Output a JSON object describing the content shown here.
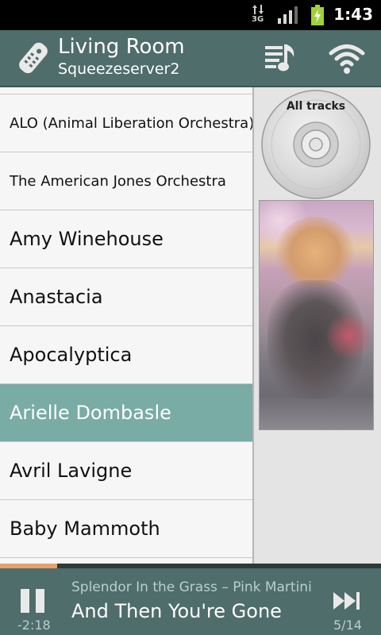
{
  "status_bar": {
    "network_label": "3G",
    "time": "1:43"
  },
  "header": {
    "title": "Living Room",
    "subtitle": "Squeezeserver2",
    "icons": [
      "remote-icon",
      "playlist-icon",
      "wifi-icon"
    ]
  },
  "artists": [
    {
      "name": "ALO (Animal Liberation Orchestra)",
      "size": "small",
      "selected": false
    },
    {
      "name": "The American Jones Orchestra",
      "size": "small",
      "selected": false
    },
    {
      "name": "Amy Winehouse",
      "size": "big",
      "selected": false
    },
    {
      "name": "Anastacia",
      "size": "big",
      "selected": false
    },
    {
      "name": "Apocalyptica",
      "size": "big",
      "selected": false
    },
    {
      "name": "Arielle Dombasle",
      "size": "big",
      "selected": true
    },
    {
      "name": "Avril Lavigne",
      "size": "big",
      "selected": false
    },
    {
      "name": "Baby Mammoth",
      "size": "big",
      "selected": false
    }
  ],
  "side_panel": {
    "all_tracks_label": "All tracks"
  },
  "now_playing": {
    "subtitle": "Splendor In the Grass – Pink Martini",
    "title": "And Then You're Gone",
    "elapsed": "-2:18",
    "track_position": "5/14",
    "progress_fraction": 0.15
  },
  "colors": {
    "header_bg": "#4f6d6a",
    "selected_row": "#78aca5",
    "progress": "#e7a06a"
  }
}
